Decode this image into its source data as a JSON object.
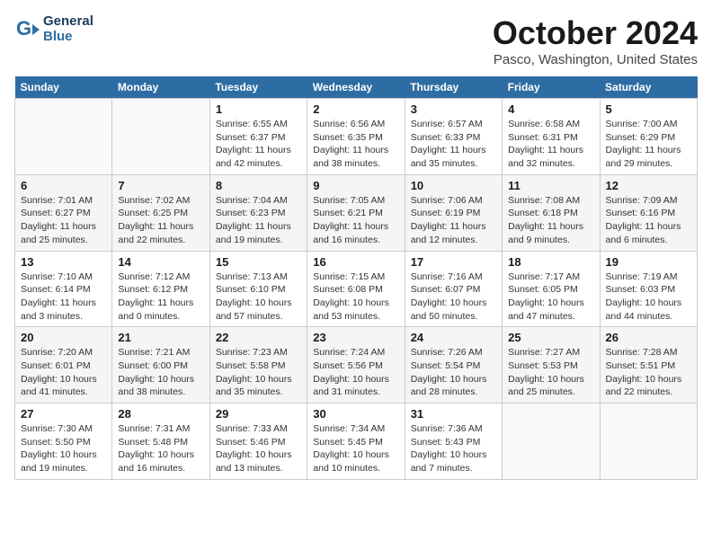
{
  "header": {
    "logo": {
      "line1": "General",
      "line2": "Blue"
    },
    "title": "October 2024",
    "location": "Pasco, Washington, United States"
  },
  "weekdays": [
    "Sunday",
    "Monday",
    "Tuesday",
    "Wednesday",
    "Thursday",
    "Friday",
    "Saturday"
  ],
  "weeks": [
    [
      {
        "day": "",
        "info": ""
      },
      {
        "day": "",
        "info": ""
      },
      {
        "day": "1",
        "info": "Sunrise: 6:55 AM\nSunset: 6:37 PM\nDaylight: 11 hours and 42 minutes."
      },
      {
        "day": "2",
        "info": "Sunrise: 6:56 AM\nSunset: 6:35 PM\nDaylight: 11 hours and 38 minutes."
      },
      {
        "day": "3",
        "info": "Sunrise: 6:57 AM\nSunset: 6:33 PM\nDaylight: 11 hours and 35 minutes."
      },
      {
        "day": "4",
        "info": "Sunrise: 6:58 AM\nSunset: 6:31 PM\nDaylight: 11 hours and 32 minutes."
      },
      {
        "day": "5",
        "info": "Sunrise: 7:00 AM\nSunset: 6:29 PM\nDaylight: 11 hours and 29 minutes."
      }
    ],
    [
      {
        "day": "6",
        "info": "Sunrise: 7:01 AM\nSunset: 6:27 PM\nDaylight: 11 hours and 25 minutes."
      },
      {
        "day": "7",
        "info": "Sunrise: 7:02 AM\nSunset: 6:25 PM\nDaylight: 11 hours and 22 minutes."
      },
      {
        "day": "8",
        "info": "Sunrise: 7:04 AM\nSunset: 6:23 PM\nDaylight: 11 hours and 19 minutes."
      },
      {
        "day": "9",
        "info": "Sunrise: 7:05 AM\nSunset: 6:21 PM\nDaylight: 11 hours and 16 minutes."
      },
      {
        "day": "10",
        "info": "Sunrise: 7:06 AM\nSunset: 6:19 PM\nDaylight: 11 hours and 12 minutes."
      },
      {
        "day": "11",
        "info": "Sunrise: 7:08 AM\nSunset: 6:18 PM\nDaylight: 11 hours and 9 minutes."
      },
      {
        "day": "12",
        "info": "Sunrise: 7:09 AM\nSunset: 6:16 PM\nDaylight: 11 hours and 6 minutes."
      }
    ],
    [
      {
        "day": "13",
        "info": "Sunrise: 7:10 AM\nSunset: 6:14 PM\nDaylight: 11 hours and 3 minutes."
      },
      {
        "day": "14",
        "info": "Sunrise: 7:12 AM\nSunset: 6:12 PM\nDaylight: 11 hours and 0 minutes."
      },
      {
        "day": "15",
        "info": "Sunrise: 7:13 AM\nSunset: 6:10 PM\nDaylight: 10 hours and 57 minutes."
      },
      {
        "day": "16",
        "info": "Sunrise: 7:15 AM\nSunset: 6:08 PM\nDaylight: 10 hours and 53 minutes."
      },
      {
        "day": "17",
        "info": "Sunrise: 7:16 AM\nSunset: 6:07 PM\nDaylight: 10 hours and 50 minutes."
      },
      {
        "day": "18",
        "info": "Sunrise: 7:17 AM\nSunset: 6:05 PM\nDaylight: 10 hours and 47 minutes."
      },
      {
        "day": "19",
        "info": "Sunrise: 7:19 AM\nSunset: 6:03 PM\nDaylight: 10 hours and 44 minutes."
      }
    ],
    [
      {
        "day": "20",
        "info": "Sunrise: 7:20 AM\nSunset: 6:01 PM\nDaylight: 10 hours and 41 minutes."
      },
      {
        "day": "21",
        "info": "Sunrise: 7:21 AM\nSunset: 6:00 PM\nDaylight: 10 hours and 38 minutes."
      },
      {
        "day": "22",
        "info": "Sunrise: 7:23 AM\nSunset: 5:58 PM\nDaylight: 10 hours and 35 minutes."
      },
      {
        "day": "23",
        "info": "Sunrise: 7:24 AM\nSunset: 5:56 PM\nDaylight: 10 hours and 31 minutes."
      },
      {
        "day": "24",
        "info": "Sunrise: 7:26 AM\nSunset: 5:54 PM\nDaylight: 10 hours and 28 minutes."
      },
      {
        "day": "25",
        "info": "Sunrise: 7:27 AM\nSunset: 5:53 PM\nDaylight: 10 hours and 25 minutes."
      },
      {
        "day": "26",
        "info": "Sunrise: 7:28 AM\nSunset: 5:51 PM\nDaylight: 10 hours and 22 minutes."
      }
    ],
    [
      {
        "day": "27",
        "info": "Sunrise: 7:30 AM\nSunset: 5:50 PM\nDaylight: 10 hours and 19 minutes."
      },
      {
        "day": "28",
        "info": "Sunrise: 7:31 AM\nSunset: 5:48 PM\nDaylight: 10 hours and 16 minutes."
      },
      {
        "day": "29",
        "info": "Sunrise: 7:33 AM\nSunset: 5:46 PM\nDaylight: 10 hours and 13 minutes."
      },
      {
        "day": "30",
        "info": "Sunrise: 7:34 AM\nSunset: 5:45 PM\nDaylight: 10 hours and 10 minutes."
      },
      {
        "day": "31",
        "info": "Sunrise: 7:36 AM\nSunset: 5:43 PM\nDaylight: 10 hours and 7 minutes."
      },
      {
        "day": "",
        "info": ""
      },
      {
        "day": "",
        "info": ""
      }
    ]
  ]
}
